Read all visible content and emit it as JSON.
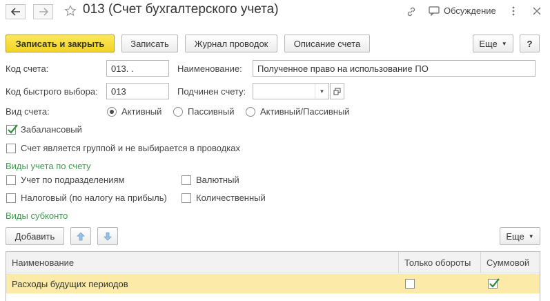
{
  "header": {
    "title": "013 (Счет бухгалтерского учета)",
    "discussion_label": "Обсуждение",
    "icons": [
      "arrow-left-icon",
      "arrow-right-icon",
      "star-icon",
      "link-icon",
      "discussion-icon",
      "more-vertical-icon",
      "close-icon"
    ]
  },
  "toolbar": {
    "save_close_label": "Записать и закрыть",
    "save_label": "Записать",
    "journal_label": "Журнал проводок",
    "description_label": "Описание счета",
    "more_label": "Еще",
    "help_label": "?"
  },
  "form": {
    "account_code_label": "Код счета:",
    "account_code_value": "013.  .",
    "name_label": "Наименование:",
    "name_value": "Полученное право на использование ПО",
    "quick_code_label": "Код быстрого выбора:",
    "quick_code_value": "013",
    "parent_label": "Подчинен счету:",
    "parent_value": "",
    "account_type_label": "Вид счета:",
    "account_type_options": [
      "Активный",
      "Пассивный",
      "Активный/Пассивный"
    ],
    "account_type_selected": "Активный",
    "offbalance_label": "Забалансовый",
    "offbalance_checked": true,
    "is_group_label": "Счет является группой и не выбирается в проводках",
    "is_group_checked": false
  },
  "accounting_types": {
    "title": "Виды учета по счету",
    "by_division_label": "Учет по подразделениям",
    "currency_label": "Валютный",
    "tax_label": "Налоговый (по налогу на прибыль)",
    "quantity_label": "Количественный"
  },
  "subconto": {
    "title": "Виды субконто",
    "add_label": "Добавить",
    "more_label": "Еще",
    "columns": [
      "Наименование",
      "Только обороты",
      "Суммовой"
    ],
    "rows": [
      {
        "name": "Расходы будущих периодов",
        "turnover_only": false,
        "sum": true
      }
    ]
  },
  "colors": {
    "primary_button": "#f5d82a",
    "section_title": "#3f9a50",
    "selected_row": "#fbeaa8",
    "check_mark": "#2e8b3a"
  }
}
